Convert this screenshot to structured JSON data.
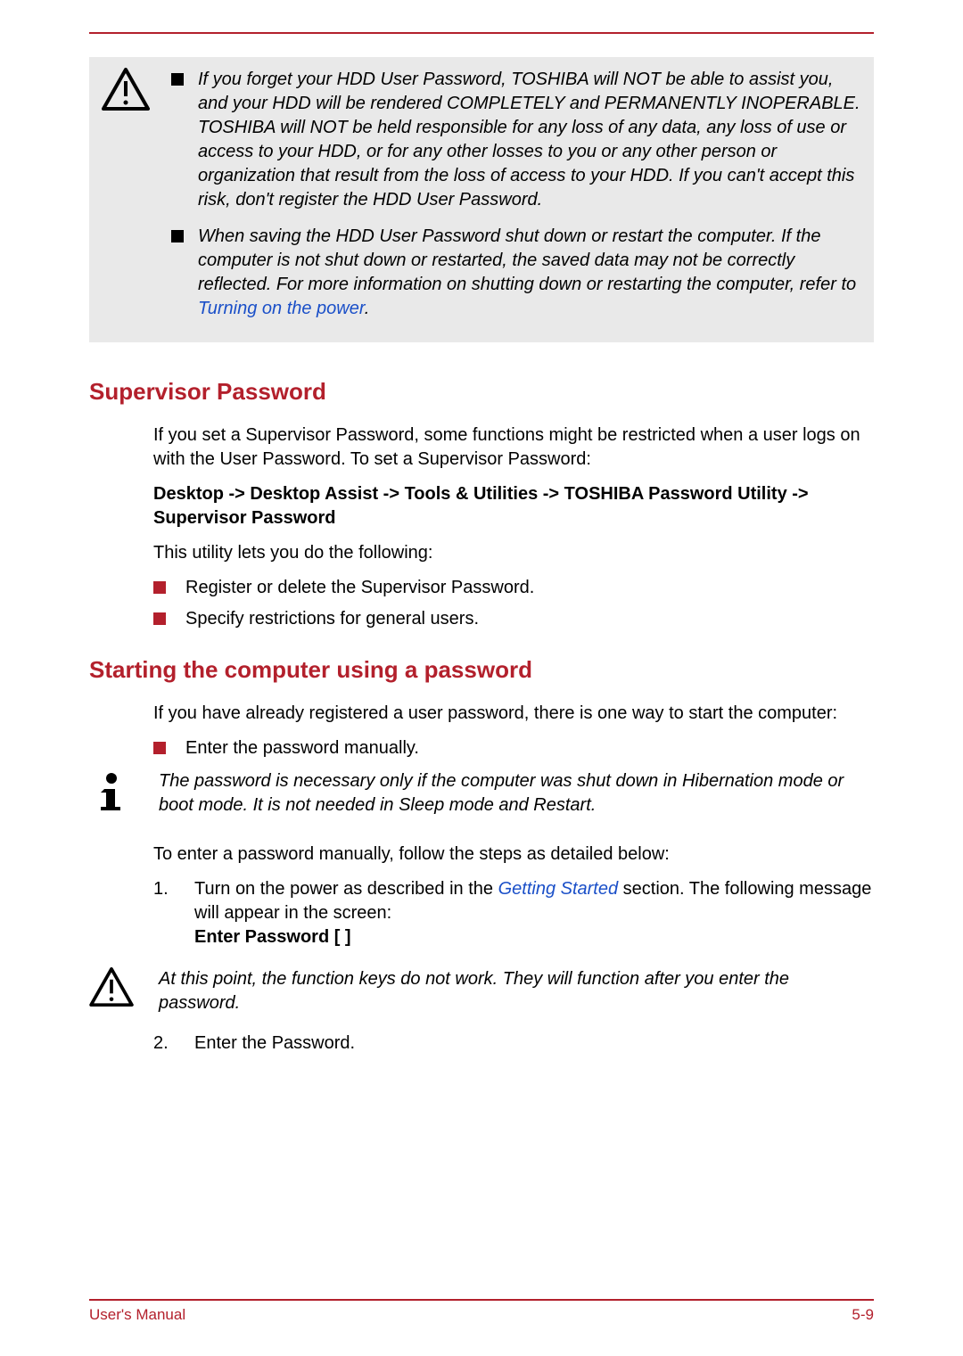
{
  "warning1": {
    "items": [
      {
        "text_before": "If you forget your HDD User Password, TOSHIBA will NOT be able to assist you, and your HDD will be rendered COMPLETELY and PERMANENTLY INOPERABLE. TOSHIBA will NOT be held responsible for any loss of any data, any loss of use or access to your HDD, or for any other losses to you or any other person or organization that result from the loss of access to your HDD. If you can't accept this risk, don't register the HDD User Password."
      },
      {
        "text_before": "When saving the HDD User Password shut down or restart the computer. If the computer is not shut down or restarted, the saved data may not be correctly reflected. For more information on shutting down or restarting the computer, refer to ",
        "link": "Turning on the power",
        "text_after": "."
      }
    ]
  },
  "sections": {
    "supervisor": {
      "heading": "Supervisor Password",
      "p1": "If you set a Supervisor Password, some functions might be restricted when a user logs on with the User Password. To set a Supervisor Password:",
      "path": "Desktop -> Desktop Assist -> Tools & Utilities -> TOSHIBA Password Utility -> Supervisor Password",
      "p2": "This utility lets you do the following:",
      "bullets": [
        "Register or delete the Supervisor Password.",
        "Specify restrictions for general users."
      ]
    },
    "starting": {
      "heading": "Starting the computer using a password",
      "p1": "If you have already registered a user password, there is one way to start the computer:",
      "bullets": [
        "Enter the password manually."
      ],
      "info_note": "The password is necessary only if the computer was shut down in Hibernation mode or boot mode. It is not needed in Sleep mode and Restart.",
      "p2": "To enter a password manually, follow the steps as detailed below:",
      "step1_before": "Turn on the power as described in the ",
      "step1_link": "Getting Started",
      "step1_after": " section. The following message will appear in the screen:",
      "step1_prompt": "Enter Password [ ]",
      "warn2": "At this point, the function keys do not work. They will function after you enter the password.",
      "step2": "Enter the Password."
    }
  },
  "footer": {
    "left": "User's Manual",
    "right": "5-9"
  }
}
